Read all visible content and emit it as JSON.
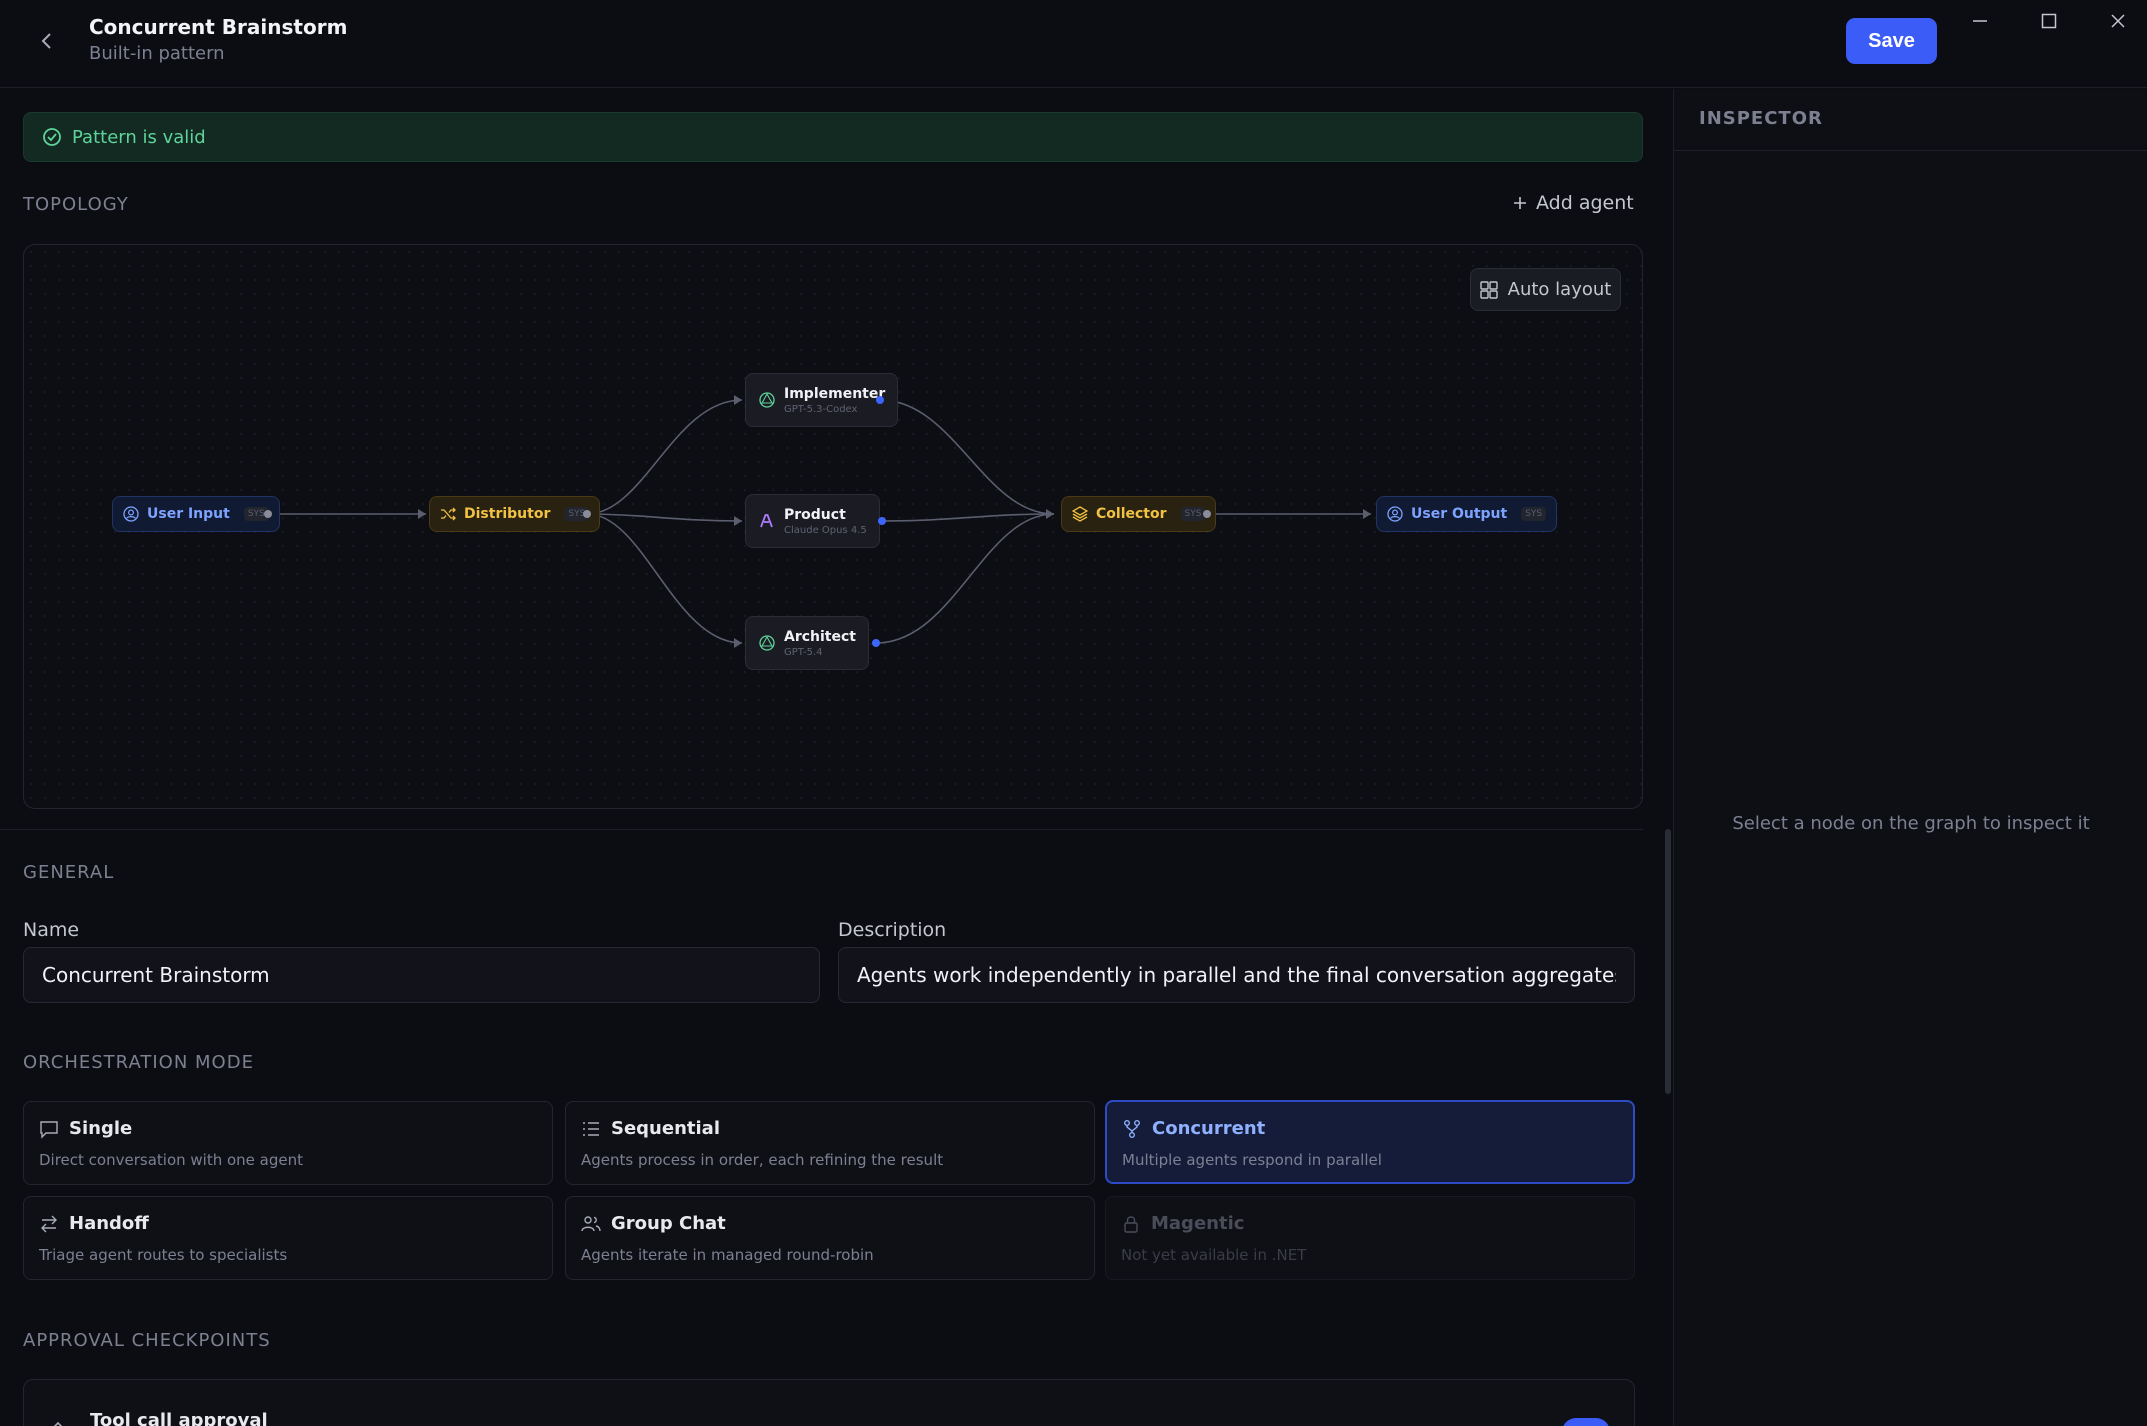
{
  "header": {
    "title": "Concurrent Brainstorm",
    "subtitle": "Built-in pattern",
    "save_label": "Save"
  },
  "validation": {
    "message": "Pattern is valid",
    "status_color": "#5fd49a"
  },
  "topology": {
    "section_label": "TOPOLOGY",
    "add_agent_label": "Add agent",
    "auto_layout_label": "Auto layout",
    "sys_badge": "SYS",
    "nodes": {
      "user_input": "User Input",
      "distributor": "Distributor",
      "implementer": {
        "name": "Implementer",
        "model": "GPT-5.3-Codex"
      },
      "product": {
        "name": "Product",
        "model": "Claude Opus 4.5"
      },
      "architect": {
        "name": "Architect",
        "model": "GPT-5.4"
      },
      "collector": "Collector",
      "user_output": "User Output"
    }
  },
  "general": {
    "section_label": "GENERAL",
    "name_label": "Name",
    "name_value": "Concurrent Brainstorm",
    "description_label": "Description",
    "description_value": "Agents work independently in parallel and the final conversation aggregates every re"
  },
  "orchestration": {
    "section_label": "ORCHESTRATION MODE",
    "modes": [
      {
        "title": "Single",
        "desc": "Direct conversation with one agent",
        "icon": "chat-icon"
      },
      {
        "title": "Sequential",
        "desc": "Agents process in order, each refining the result",
        "icon": "list-icon"
      },
      {
        "title": "Concurrent",
        "desc": "Multiple agents respond in parallel",
        "icon": "fork-icon",
        "selected": true
      },
      {
        "title": "Handoff",
        "desc": "Triage agent routes to specialists",
        "icon": "swap-icon"
      },
      {
        "title": "Group Chat",
        "desc": "Agents iterate in managed round-robin",
        "icon": "group-icon"
      },
      {
        "title": "Magentic",
        "desc": "Not yet available in .NET",
        "icon": "lock-icon",
        "disabled": true
      }
    ]
  },
  "approval": {
    "section_label": "APPROVAL CHECKPOINTS",
    "item_title": "Tool call approval"
  },
  "inspector": {
    "title": "INSPECTOR",
    "empty_message": "Select a node on the graph to inspect it"
  },
  "colors": {
    "accent": "#3b5cf6",
    "system_node": "#7ea3ff",
    "router_node": "#f2c244"
  }
}
